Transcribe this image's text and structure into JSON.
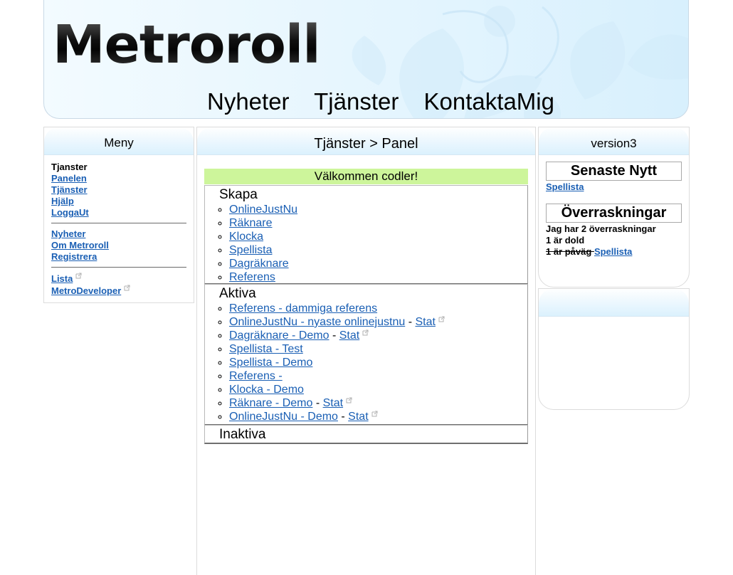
{
  "site": {
    "logo": "Metroroll",
    "nav": [
      "Nyheter",
      "Tjänster",
      "KontaktaMig"
    ]
  },
  "left": {
    "title": "Meny",
    "heading": "Tjanster",
    "group1": [
      "Panelen",
      "Tjänster",
      "Hjälp",
      "LoggaUt"
    ],
    "group2": [
      "Nyheter",
      "Om Metroroll",
      "Registrera"
    ],
    "group3": [
      "Lista",
      "MetroDeveloper"
    ]
  },
  "center": {
    "breadcrumb": "Tjänster > Panel",
    "welcome": "Välkommen codler!",
    "skapa": {
      "title": "Skapa",
      "items": [
        "OnlineJustNu",
        "Räknare",
        "Klocka",
        "Spellista",
        "Dagräknare",
        "Referens"
      ]
    },
    "aktiva": {
      "title": "Aktiva",
      "items": [
        {
          "parts": [
            {
              "t": "Referens - dammiga referens",
              "link": true
            }
          ]
        },
        {
          "parts": [
            {
              "t": "OnlineJustNu - nyaste onlinejustnu",
              "link": true
            },
            {
              "t": " - ",
              "link": false
            },
            {
              "t": "Stat",
              "link": true,
              "ext": true
            }
          ]
        },
        {
          "parts": [
            {
              "t": "Dagräknare - Demo",
              "link": true
            },
            {
              "t": " - ",
              "link": false
            },
            {
              "t": "Stat",
              "link": true,
              "ext": true
            }
          ]
        },
        {
          "parts": [
            {
              "t": "Spellista - Test",
              "link": true
            }
          ]
        },
        {
          "parts": [
            {
              "t": "Spellista - Demo",
              "link": true
            }
          ]
        },
        {
          "parts": [
            {
              "t": "Referens - ",
              "link": true
            }
          ]
        },
        {
          "parts": [
            {
              "t": "Klocka - Demo",
              "link": true
            }
          ]
        },
        {
          "parts": [
            {
              "t": "Räknare - Demo",
              "link": true
            },
            {
              "t": " - ",
              "link": false
            },
            {
              "t": "Stat",
              "link": true,
              "ext": true
            }
          ]
        },
        {
          "parts": [
            {
              "t": "OnlineJustNu - Demo",
              "link": true
            },
            {
              "t": " - ",
              "link": false
            },
            {
              "t": "Stat",
              "link": true,
              "ext": true
            }
          ]
        }
      ]
    },
    "inaktiva": {
      "title": "Inaktiva"
    }
  },
  "right": {
    "version": "version3",
    "senaste": {
      "title": "Senaste Nytt",
      "link": "Spellista"
    },
    "overraskningar": {
      "title": "Överraskningar",
      "line1": "Jag har 2 överraskningar",
      "line2": "1 är dold",
      "line3_struck": "1 är påväg ",
      "line3_link": "Spellista"
    }
  },
  "colors": {
    "link": "#1a5fb4",
    "welcome_bg": "#cdf59b",
    "header_bg": "#e7f6fe"
  }
}
